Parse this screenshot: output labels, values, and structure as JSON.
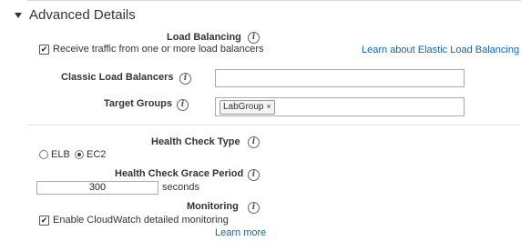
{
  "section": {
    "title": "Advanced Details"
  },
  "load_balancing": {
    "title": "Load Balancing",
    "receive_traffic_label": "Receive traffic from one or more load balancers",
    "receive_traffic_checked": true,
    "learn_more_link": "Learn about Elastic Load Balancing",
    "classic_lb_label": "Classic Load Balancers",
    "classic_lb_value": "",
    "target_groups_label": "Target Groups",
    "target_groups": [
      "LabGroup"
    ],
    "token_remove": "×"
  },
  "health_check": {
    "type_label": "Health Check Type",
    "options": [
      "ELB",
      "EC2"
    ],
    "selected": "EC2",
    "grace_label": "Health Check Grace Period",
    "grace_value": "300",
    "grace_unit": "seconds"
  },
  "monitoring": {
    "title": "Monitoring",
    "cloudwatch_label": "Enable CloudWatch detailed monitoring",
    "cloudwatch_checked": true,
    "learn_more": "Learn more"
  },
  "icons": {
    "info_glyph": "i",
    "check_glyph": "✔"
  }
}
